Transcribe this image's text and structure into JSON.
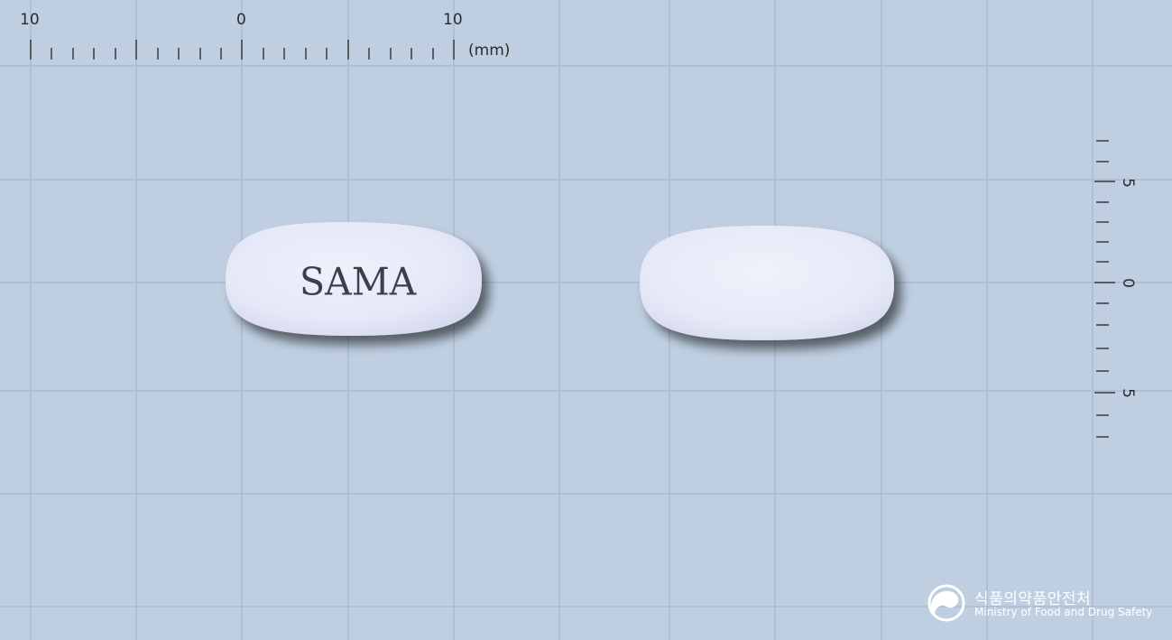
{
  "ruler_horizontal": {
    "labels": [
      "10",
      "0",
      "10"
    ],
    "unit": "(mm)"
  },
  "ruler_vertical": {
    "labels": [
      "5",
      "0",
      "5"
    ]
  },
  "tablet_front": {
    "imprint": "SAMA",
    "color": "#e8ebf8"
  },
  "tablet_back": {
    "imprint": "",
    "color": "#e9ecf8"
  },
  "logo": {
    "name_korean": "식품의약품안전처",
    "name_english": "Ministry of Food and Drug Safety"
  },
  "colors": {
    "background": "#bfcfe1",
    "grid": "#a9bbcf"
  }
}
